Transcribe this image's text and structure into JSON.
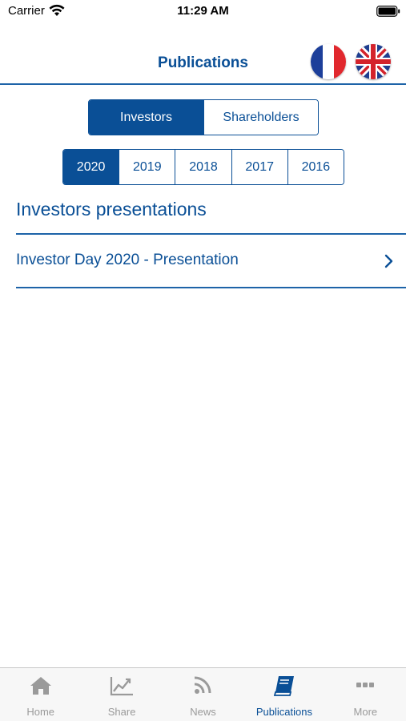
{
  "status_bar": {
    "carrier": "Carrier",
    "time": "11:29 AM",
    "icons": [
      "wifi-icon",
      "battery-icon"
    ]
  },
  "header": {
    "title": "Publications",
    "flags": [
      {
        "name": "flag-france-icon",
        "lang": "French"
      },
      {
        "name": "flag-uk-icon",
        "lang": "English"
      }
    ]
  },
  "segment": {
    "options": [
      "Investors",
      "Shareholders"
    ],
    "selected": "Investors"
  },
  "years": {
    "options": [
      "2020",
      "2019",
      "2018",
      "2017",
      "2016"
    ],
    "selected": "2020"
  },
  "section": {
    "title": "Investors presentations",
    "items": [
      {
        "label": "Investor Day 2020 - Presentation",
        "icon": "chevron-right-icon"
      }
    ]
  },
  "tabbar": {
    "items": [
      {
        "label": "Home",
        "icon": "home-icon"
      },
      {
        "label": "Share",
        "icon": "chart-icon"
      },
      {
        "label": "News",
        "icon": "rss-icon"
      },
      {
        "label": "Publications",
        "icon": "book-icon"
      },
      {
        "label": "More",
        "icon": "more-icon"
      }
    ],
    "selected": "Publications"
  },
  "colors": {
    "accent": "#0a4f96",
    "inactive_tab": "#9a9a9a",
    "tabbar_bg": "#f7f7f7"
  }
}
